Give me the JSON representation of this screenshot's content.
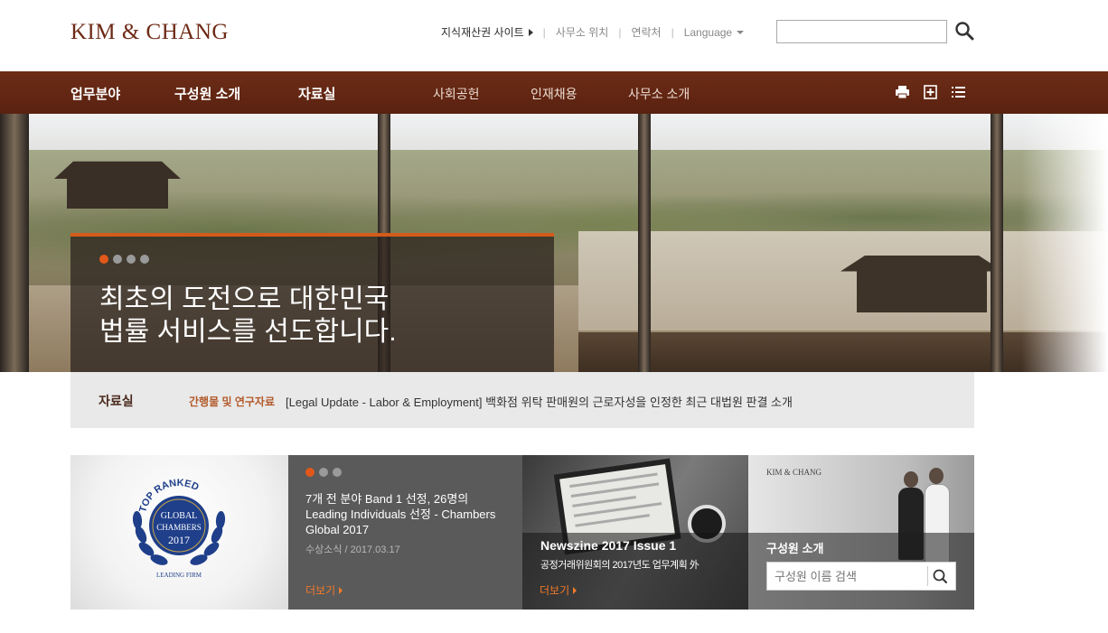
{
  "header": {
    "logo": "KIM & CHANG",
    "util_links": {
      "ip_site": "지식재산권 사이트",
      "office_location": "사무소 위치",
      "contact": "연락처",
      "language": "Language"
    },
    "search": {
      "value": "",
      "icon": "search-icon"
    }
  },
  "nav": {
    "primary": [
      "업무분야",
      "구성원 소개",
      "자료실"
    ],
    "secondary": [
      "사회공헌",
      "인재채용",
      "사무소 소개"
    ],
    "tools": [
      "print-icon",
      "add-icon",
      "list-icon"
    ],
    "colors": {
      "background": "#6d2d17"
    }
  },
  "hero": {
    "headline_line1": "최초의 도전으로 대한민국",
    "headline_line2": "법률 서비스를 선도합니다.",
    "slides_total": 4,
    "active_slide": 1,
    "accent_color": "#d45b1a"
  },
  "ticker": {
    "title": "자료실",
    "category": "간행물 및 연구자료",
    "text": "[Legal Update - Labor & Employment] 백화점 위탁 판매원의 근로자성을 인정한 최근 대법원 판결 소개"
  },
  "cards": {
    "award": {
      "badge_text": {
        "top": "TOP RANKED",
        "global": "GLOBAL",
        "chambers": "CHAMBERS",
        "year": "2017",
        "bottom": "LEADING FIRM"
      }
    },
    "news": {
      "slides_total": 3,
      "active_slide": 1,
      "title": "7개 전 분야 Band 1 선정, 26명의 Leading Individuals 선정 - Chambers Global 2017",
      "meta": "수상소식 / 2017.03.17",
      "more": "더보기"
    },
    "newszine": {
      "title": "Newszine 2017 Issue 1",
      "subtitle": "공정거래위원회의 2017년도 업무계획 外",
      "more": "더보기"
    },
    "people": {
      "logo": "KIM & CHANG",
      "title": "구성원 소개",
      "search_placeholder": "구성원 이름 검색"
    }
  }
}
